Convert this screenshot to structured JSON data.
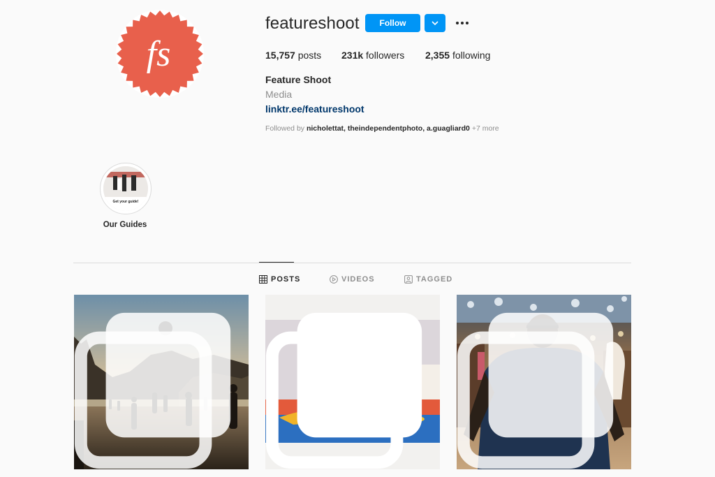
{
  "profile": {
    "username": "featureshoot",
    "avatar_monogram": "fs",
    "follow_label": "Follow",
    "stats": {
      "posts_count": "15,757",
      "posts_label": "posts",
      "followers_count": "231k",
      "followers_label": "followers",
      "following_count": "2,355",
      "following_label": "following"
    },
    "full_name": "Feature Shoot",
    "category": "Media",
    "link": "linktr.ee/featureshoot",
    "followed_by": {
      "prefix": "Followed by",
      "names": "nicholettat, theindependentphoto, a.guagliard0",
      "more": "+7 more"
    }
  },
  "highlights": [
    {
      "label": "Our Guides",
      "thumb_text": "Get your guide!"
    }
  ],
  "tabs": [
    {
      "label": "POSTS",
      "icon": "grid-icon",
      "active": true
    },
    {
      "label": "VIDEOS",
      "icon": "play-icon",
      "active": false
    },
    {
      "label": "TAGGED",
      "icon": "tag-icon",
      "active": false
    }
  ],
  "posts": [
    {
      "subject": "beach-soccer-silhouettes",
      "carousel": true
    },
    {
      "subject": "costumed-figure-on-bed",
      "carousel": true
    },
    {
      "subject": "man-in-dance-hall",
      "carousel": true
    }
  ],
  "colors": {
    "accent": "#0095f6",
    "avatar": "#e8604c",
    "link": "#00376b",
    "muted": "#8e8e8e",
    "text": "#262626"
  }
}
